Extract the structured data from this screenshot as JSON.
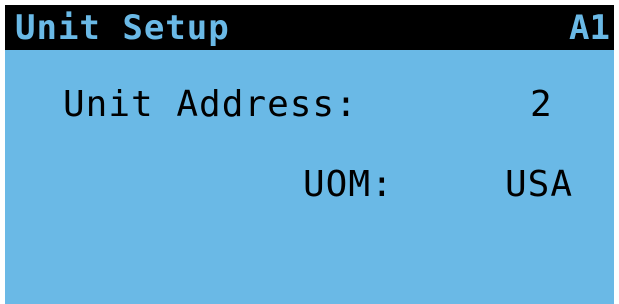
{
  "colors": {
    "screen_background": "#6ab9e6",
    "title_bar": "#000000",
    "text": "#000000"
  },
  "header": {
    "title": "Unit Setup",
    "screen_id": "A1"
  },
  "fields": {
    "unit_address": {
      "label": "Unit Address:",
      "value": "2"
    },
    "uom": {
      "label": "UOM:",
      "value": "USA"
    }
  }
}
